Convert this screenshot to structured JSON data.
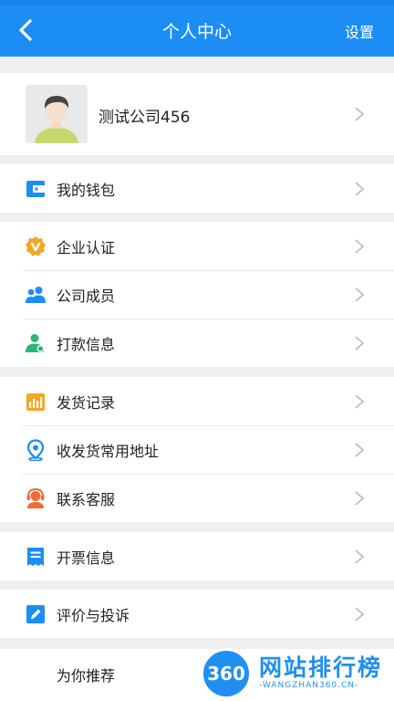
{
  "header": {
    "title": "个人中心",
    "settings_label": "设置",
    "back_icon": "chevron-left-icon",
    "color": "#1b8df5"
  },
  "profile": {
    "company_name": "测试公司456",
    "avatar_icon": "user-avatar-icon"
  },
  "sections": {
    "wallet": {
      "label": "我的钱包",
      "icon": "wallet-icon",
      "color": "#1b8df5"
    },
    "certification": {
      "label": "企业认证",
      "icon": "badge-v-icon",
      "color": "#f5a623"
    },
    "members": {
      "label": "公司成员",
      "icon": "users-icon",
      "color": "#1b8df5"
    },
    "payment_info": {
      "label": "打款信息",
      "icon": "user-money-icon",
      "color": "#2bb673"
    },
    "shipping_records": {
      "label": "发货记录",
      "icon": "chart-bars-icon",
      "color": "#f5a623"
    },
    "addresses": {
      "label": "收发货常用地址",
      "icon": "location-pin-icon",
      "color": "#1b8df5"
    },
    "customer_service": {
      "label": "联系客服",
      "icon": "headset-icon",
      "color": "#f06a35"
    },
    "invoice_info": {
      "label": "开票信息",
      "icon": "receipt-icon",
      "color": "#1b8df5"
    },
    "reviews": {
      "label": "评价与投诉",
      "icon": "pen-icon",
      "color": "#1b8df5"
    },
    "recommend": {
      "label": "为你推荐"
    }
  },
  "watermark": {
    "number": "360",
    "title": "网站排行榜",
    "subtitle": "-WANGZHAN360.CN-"
  }
}
